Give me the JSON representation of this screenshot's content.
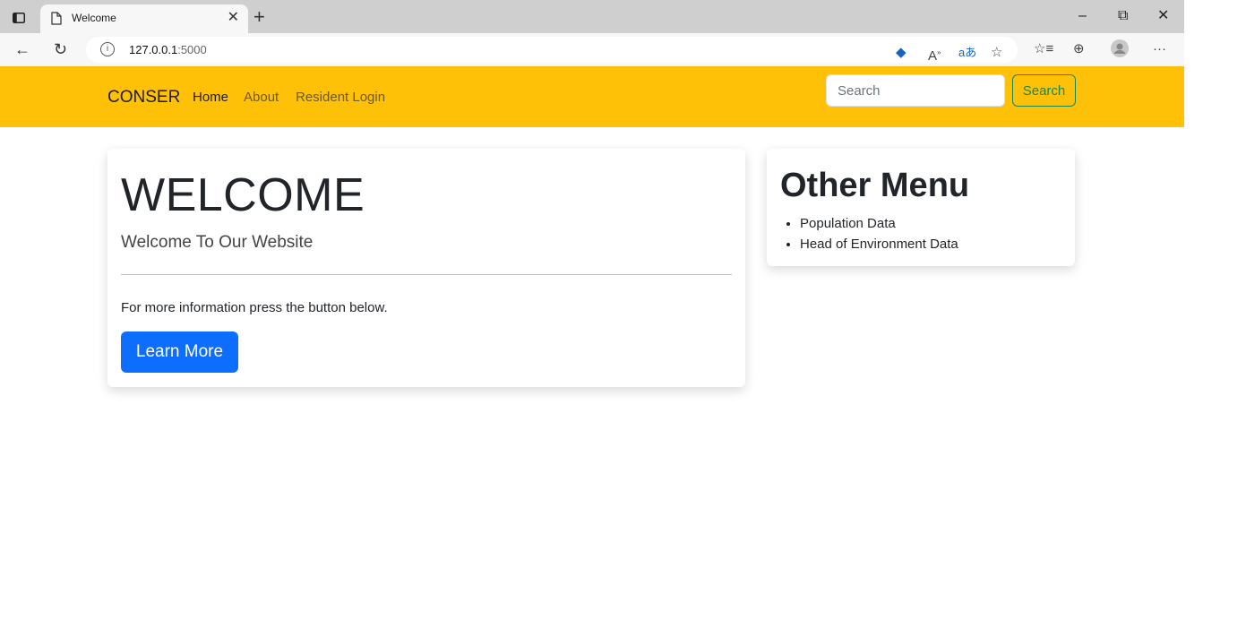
{
  "browser": {
    "tab_title": "Welcome",
    "url_host": "127.0.0.1",
    "url_port": ":5000",
    "icons": [
      "tab-actions-icon",
      "page-icon",
      "close-icon",
      "plus-icon",
      "minimize-icon",
      "restore-icon",
      "close-window-icon",
      "back-icon",
      "refresh-icon",
      "info-icon",
      "tag-icon",
      "read-aloud-icon",
      "translate-icon",
      "favorite-add-icon",
      "favorites-icon",
      "collections-icon",
      "profile-icon",
      "more-icon"
    ]
  },
  "nav": {
    "brand": "CONSER",
    "links": [
      "Home",
      "About",
      "Resident Login"
    ],
    "search_placeholder": "Search",
    "search_button": "Search",
    "background": "#ffc107"
  },
  "main": {
    "title": "WELCOME",
    "lead": "Welcome To Our Website",
    "info": "For more information press the button below.",
    "button": "Learn More",
    "button_color": "#0d6efd"
  },
  "side": {
    "title": "Other Menu",
    "items": [
      "Population Data",
      "Head of Environment Data"
    ]
  }
}
